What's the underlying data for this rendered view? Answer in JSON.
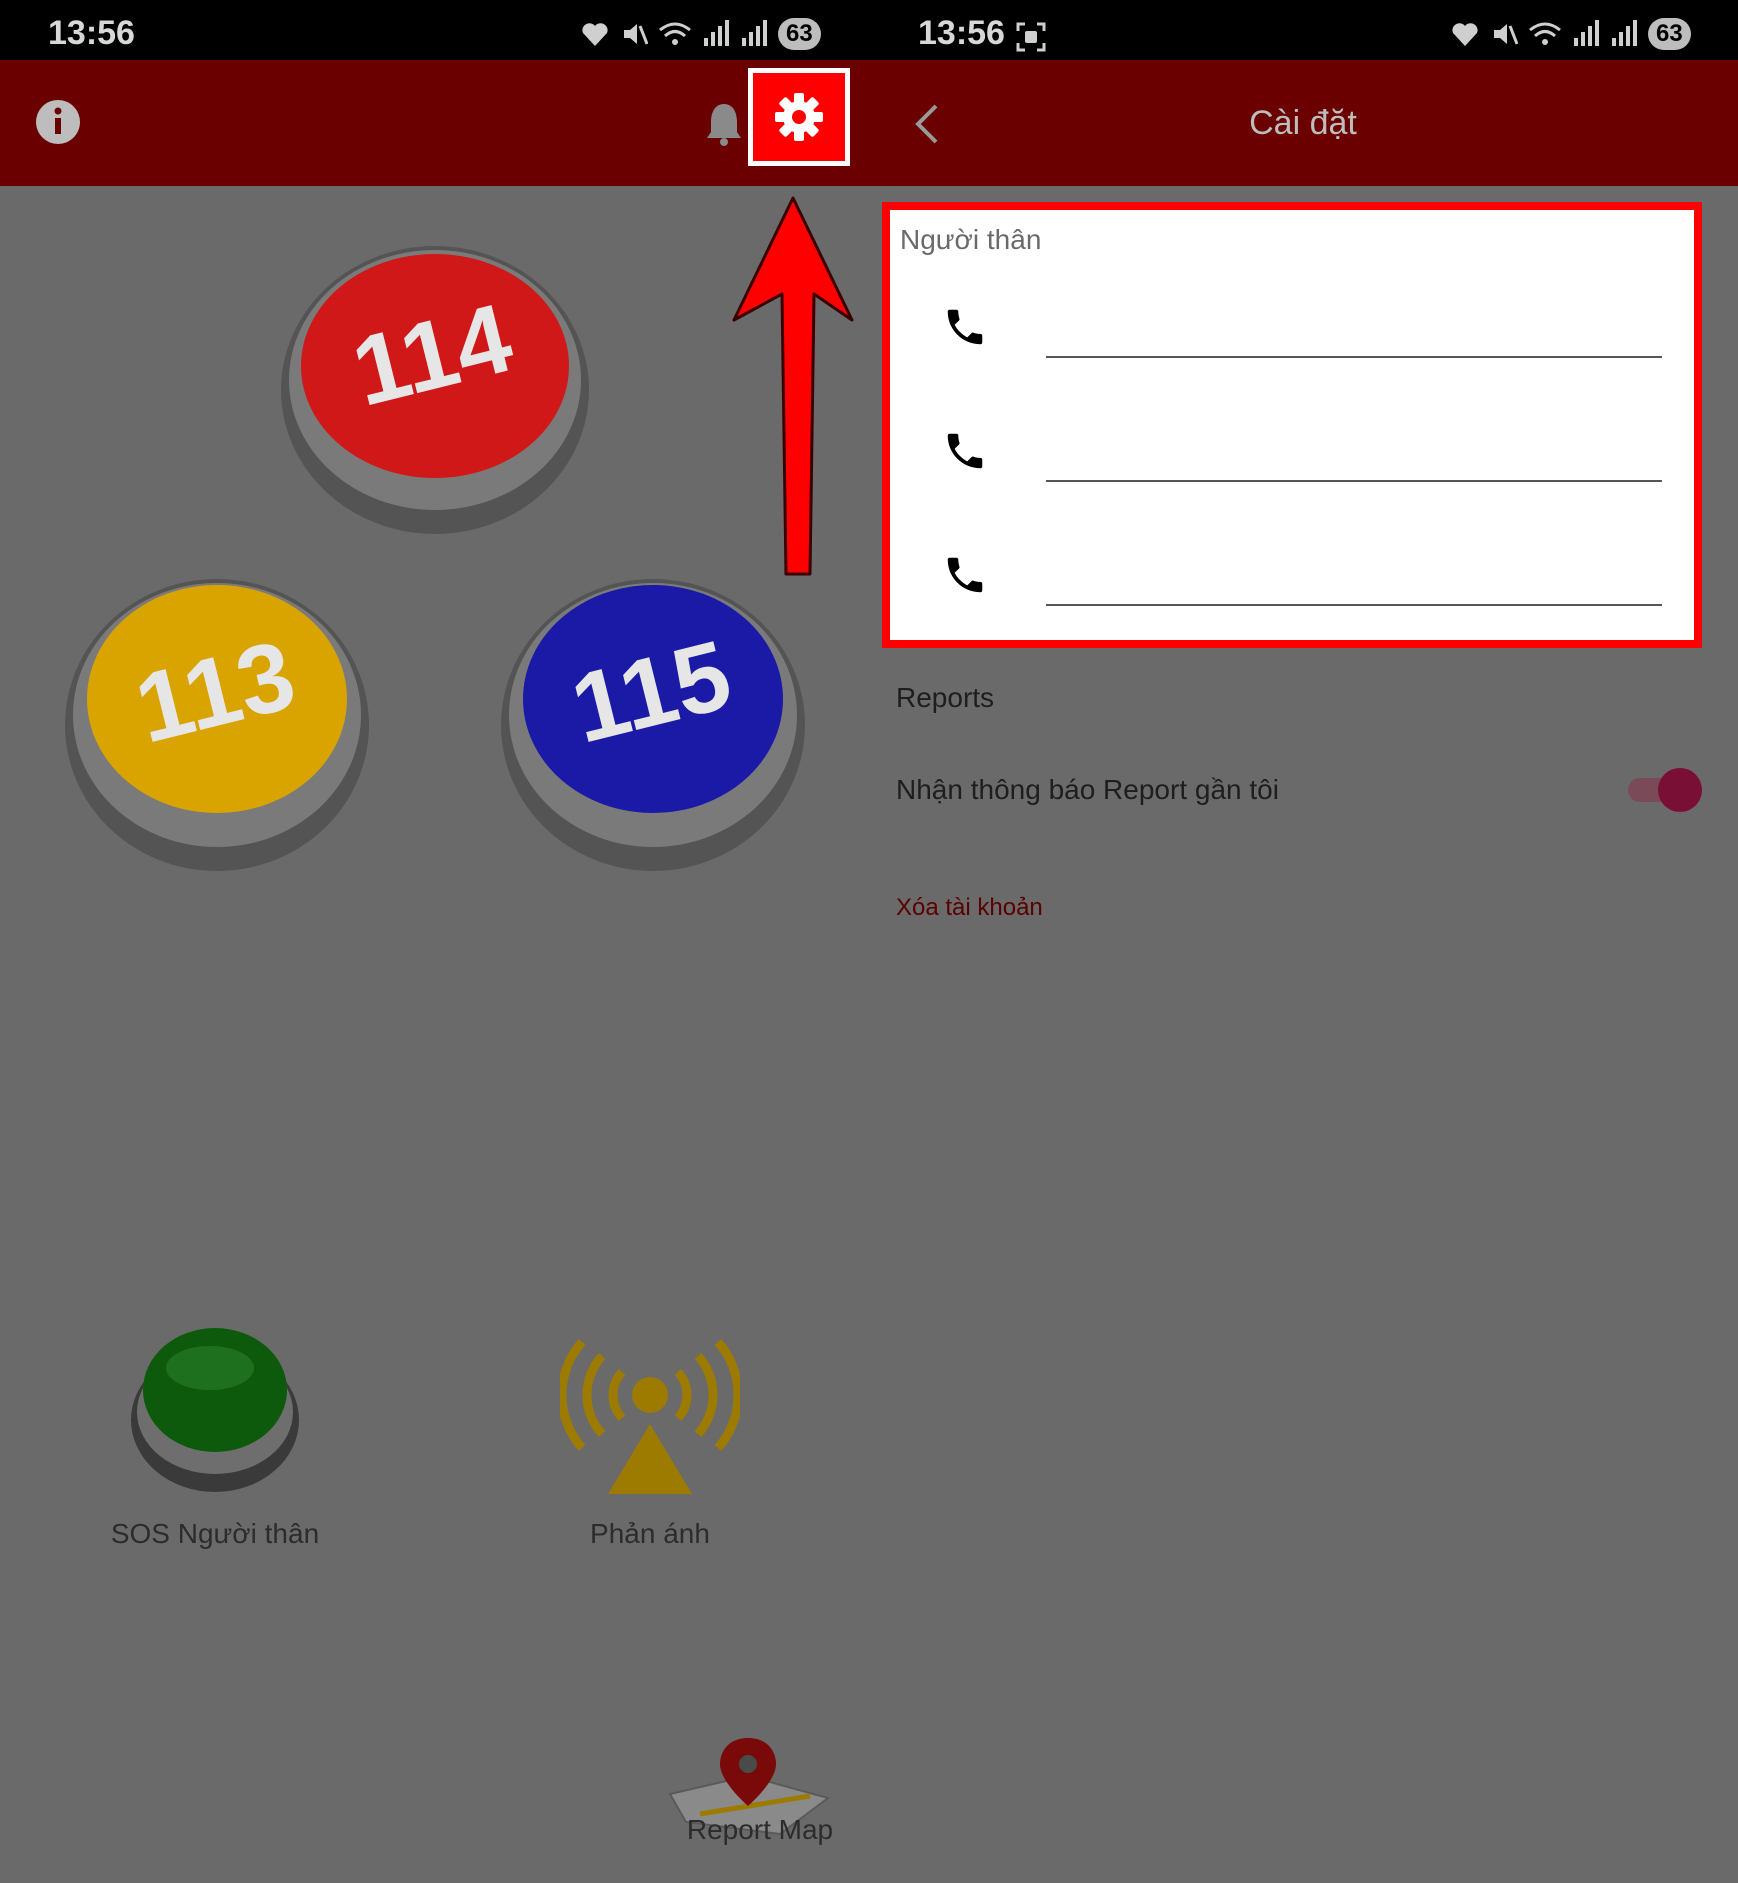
{
  "status_bar": {
    "time_left": "13:56",
    "time_right": "13:56",
    "battery": "63"
  },
  "home": {
    "buttons": [
      {
        "label": "114",
        "color": "#d01818"
      },
      {
        "label": "113",
        "color": "#d9a300"
      },
      {
        "label": "115",
        "color": "#1a1aa6"
      }
    ],
    "sos_label": "SOS Người thân",
    "feedback_label": "Phản ánh",
    "report_map_label": "Report Map"
  },
  "settings": {
    "title": "Cài đặt",
    "relatives_section": "Người thân",
    "contacts": [
      {
        "value": "",
        "icon": "phone-icon"
      },
      {
        "value": "",
        "icon": "phone-icon"
      },
      {
        "value": "",
        "icon": "phone-icon"
      }
    ],
    "reports_section": "Reports",
    "notify_label": "Nhận thông báo Report gần tôi",
    "notify_enabled": true,
    "delete_account": "Xóa tài khoản"
  },
  "colors": {
    "appbar": "#6a0000",
    "highlight": "#ff0000",
    "accent": "#c0184a"
  }
}
